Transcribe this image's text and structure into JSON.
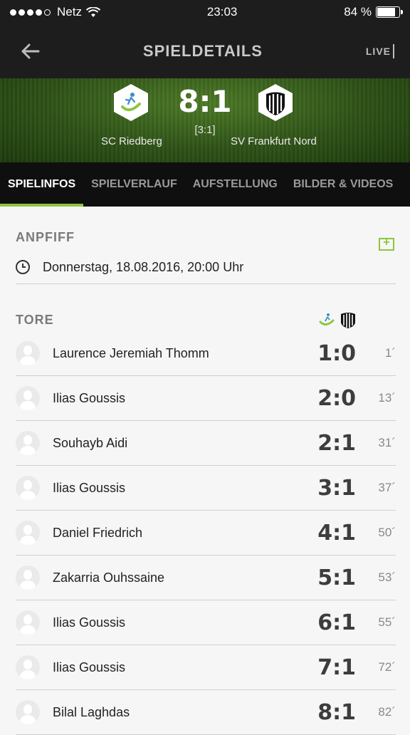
{
  "status": {
    "carrier": "Netz",
    "time": "23:03",
    "battery": "84 %",
    "battery_level": 0.84
  },
  "nav": {
    "title": "SPIELDETAILS",
    "live_label": "LIVE"
  },
  "match": {
    "score": "8:1",
    "halftime": "[3:1]",
    "home_team": "SC Riedberg",
    "away_team": "SV Frankfurt Nord"
  },
  "tabs": [
    {
      "label": "SPIELINFOS",
      "active": true
    },
    {
      "label": "SPIELVERLAUF",
      "active": false
    },
    {
      "label": "AUFSTELLUNG",
      "active": false
    },
    {
      "label": "BILDER & VIDEOS",
      "active": false
    }
  ],
  "anpfiff": {
    "title": "ANPFIFF",
    "datetime": "Donnerstag, 18.08.2016, 20:00 Uhr"
  },
  "tore": {
    "title": "TORE",
    "goals": [
      {
        "player": "Laurence Jeremiah Thomm",
        "score": "1:0",
        "minute": "1´"
      },
      {
        "player": "Ilias Goussis",
        "score": "2:0",
        "minute": "13´"
      },
      {
        "player": "Souhayb Aidi",
        "score": "2:1",
        "minute": "31´"
      },
      {
        "player": "Ilias Goussis",
        "score": "3:1",
        "minute": "37´"
      },
      {
        "player": "Daniel Friedrich",
        "score": "4:1",
        "minute": "50´"
      },
      {
        "player": "Zakarria Ouhssaine",
        "score": "5:1",
        "minute": "53´"
      },
      {
        "player": "Ilias Goussis",
        "score": "6:1",
        "minute": "55´"
      },
      {
        "player": "Ilias Goussis",
        "score": "7:1",
        "minute": "72´"
      },
      {
        "player": "Bilal Laghdas",
        "score": "8:1",
        "minute": "82´"
      }
    ]
  },
  "colors": {
    "accent": "#8cc63f",
    "header_bg": "#1d1d1d",
    "tabs_bg": "#0f0f0f"
  }
}
